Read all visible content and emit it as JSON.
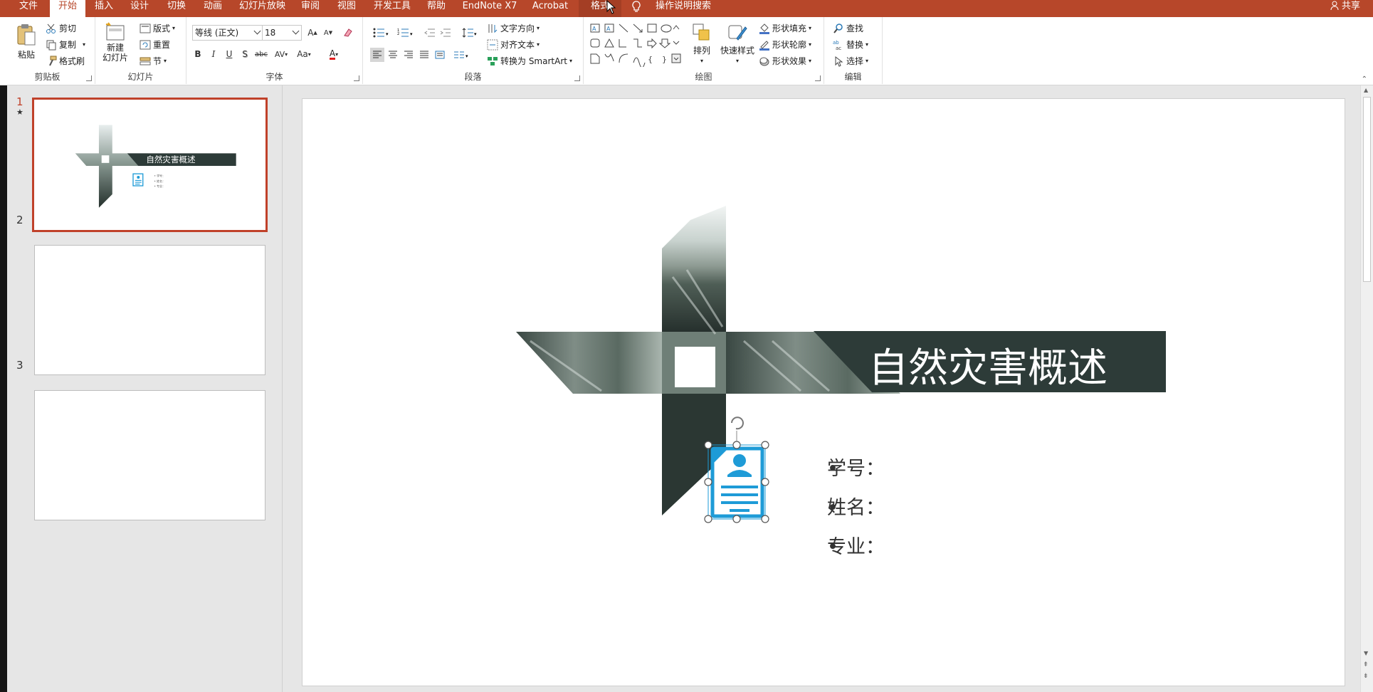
{
  "tabs": [
    {
      "id": "file",
      "label": "文件"
    },
    {
      "id": "home",
      "label": "开始"
    },
    {
      "id": "insert",
      "label": "插入"
    },
    {
      "id": "design",
      "label": "设计"
    },
    {
      "id": "transitions",
      "label": "切换"
    },
    {
      "id": "animations",
      "label": "动画"
    },
    {
      "id": "slideshow",
      "label": "幻灯片放映"
    },
    {
      "id": "review",
      "label": "审阅"
    },
    {
      "id": "view",
      "label": "视图"
    },
    {
      "id": "developer",
      "label": "开发工具"
    },
    {
      "id": "help",
      "label": "帮助"
    },
    {
      "id": "endnote",
      "label": "EndNote X7"
    },
    {
      "id": "acrobat",
      "label": "Acrobat"
    },
    {
      "id": "format",
      "label": "格式"
    }
  ],
  "tell_me": "操作说明搜索",
  "share": "共享",
  "ribbon": {
    "clipboard": {
      "label": "剪贴板",
      "paste": "粘贴",
      "cut": "剪切",
      "copy": "复制",
      "format_painter": "格式刷"
    },
    "slides": {
      "label": "幻灯片",
      "new_slide_line1": "新建",
      "new_slide_line2": "幻灯片",
      "layout": "版式",
      "reset": "重置",
      "section": "节"
    },
    "font": {
      "label": "字体",
      "font_name": "等线 (正文)",
      "font_size": "18",
      "bold": "B",
      "italic": "I",
      "underline": "U",
      "shadow": "S",
      "strike": "abc",
      "spacing": "AV",
      "case": "Aa",
      "color_a": "A"
    },
    "paragraph": {
      "label": "段落",
      "text_direction": "文字方向",
      "align_text": "对齐文本",
      "convert_smartart": "转换为 SmartArt"
    },
    "drawing": {
      "label": "绘图",
      "arrange": "排列",
      "quick_styles": "快速样式",
      "shape_fill": "形状填充",
      "shape_outline": "形状轮廓",
      "shape_effects": "形状效果"
    },
    "editing": {
      "label": "编辑",
      "find": "查找",
      "replace": "替换",
      "select": "选择"
    }
  },
  "thumbnails": [
    {
      "num": "1",
      "star": "★"
    },
    {
      "num": "2"
    },
    {
      "num": "3"
    }
  ],
  "slide": {
    "title": "自然灾害概述",
    "bullets": [
      "学号：",
      "姓名：",
      "专业："
    ]
  },
  "colors": {
    "accent": "#b7472a",
    "band": "#2d3b38",
    "icon": "#1e9bd7"
  }
}
